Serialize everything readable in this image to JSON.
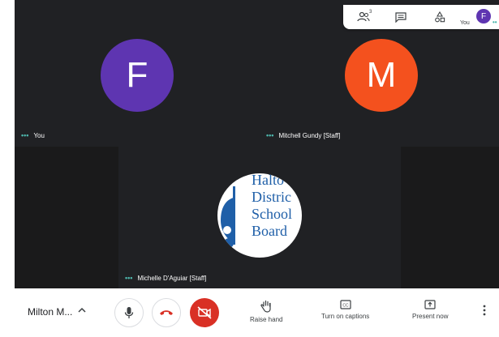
{
  "colors": {
    "stage_bg": "#202124",
    "tile_bg": "#3c4043",
    "avatar_f": "#5e35b1",
    "avatar_m": "#f4511e",
    "accent_teal": "#4db6ac",
    "end_call_red": "#d93025",
    "logo_blue": "#1f5fa8"
  },
  "participants": [
    {
      "name": "You",
      "initial": "F"
    },
    {
      "name": "Mitchell Gundy [Staff]",
      "initial": "M"
    },
    {
      "name": "Michelle D'Aguiar [Staff]",
      "logo_lines": [
        "Halto",
        "Distric",
        "School",
        "Board"
      ]
    }
  ],
  "top_panel": {
    "people_count": "3",
    "self_label": "You",
    "self_initial": "F",
    "icons": [
      "people-icon",
      "chat-icon",
      "activities-icon"
    ]
  },
  "bottom_bar": {
    "meeting_name": "Milton M...",
    "controls": {
      "mic_icon": "microphone-icon",
      "end_call_icon": "hang-up-icon",
      "camera_icon": "camera-off-icon"
    },
    "actions": [
      {
        "label": "Raise hand",
        "icon": "hand-icon"
      },
      {
        "label": "Turn on captions",
        "icon": "captions-icon"
      },
      {
        "label": "Present now",
        "icon": "present-icon"
      }
    ]
  }
}
